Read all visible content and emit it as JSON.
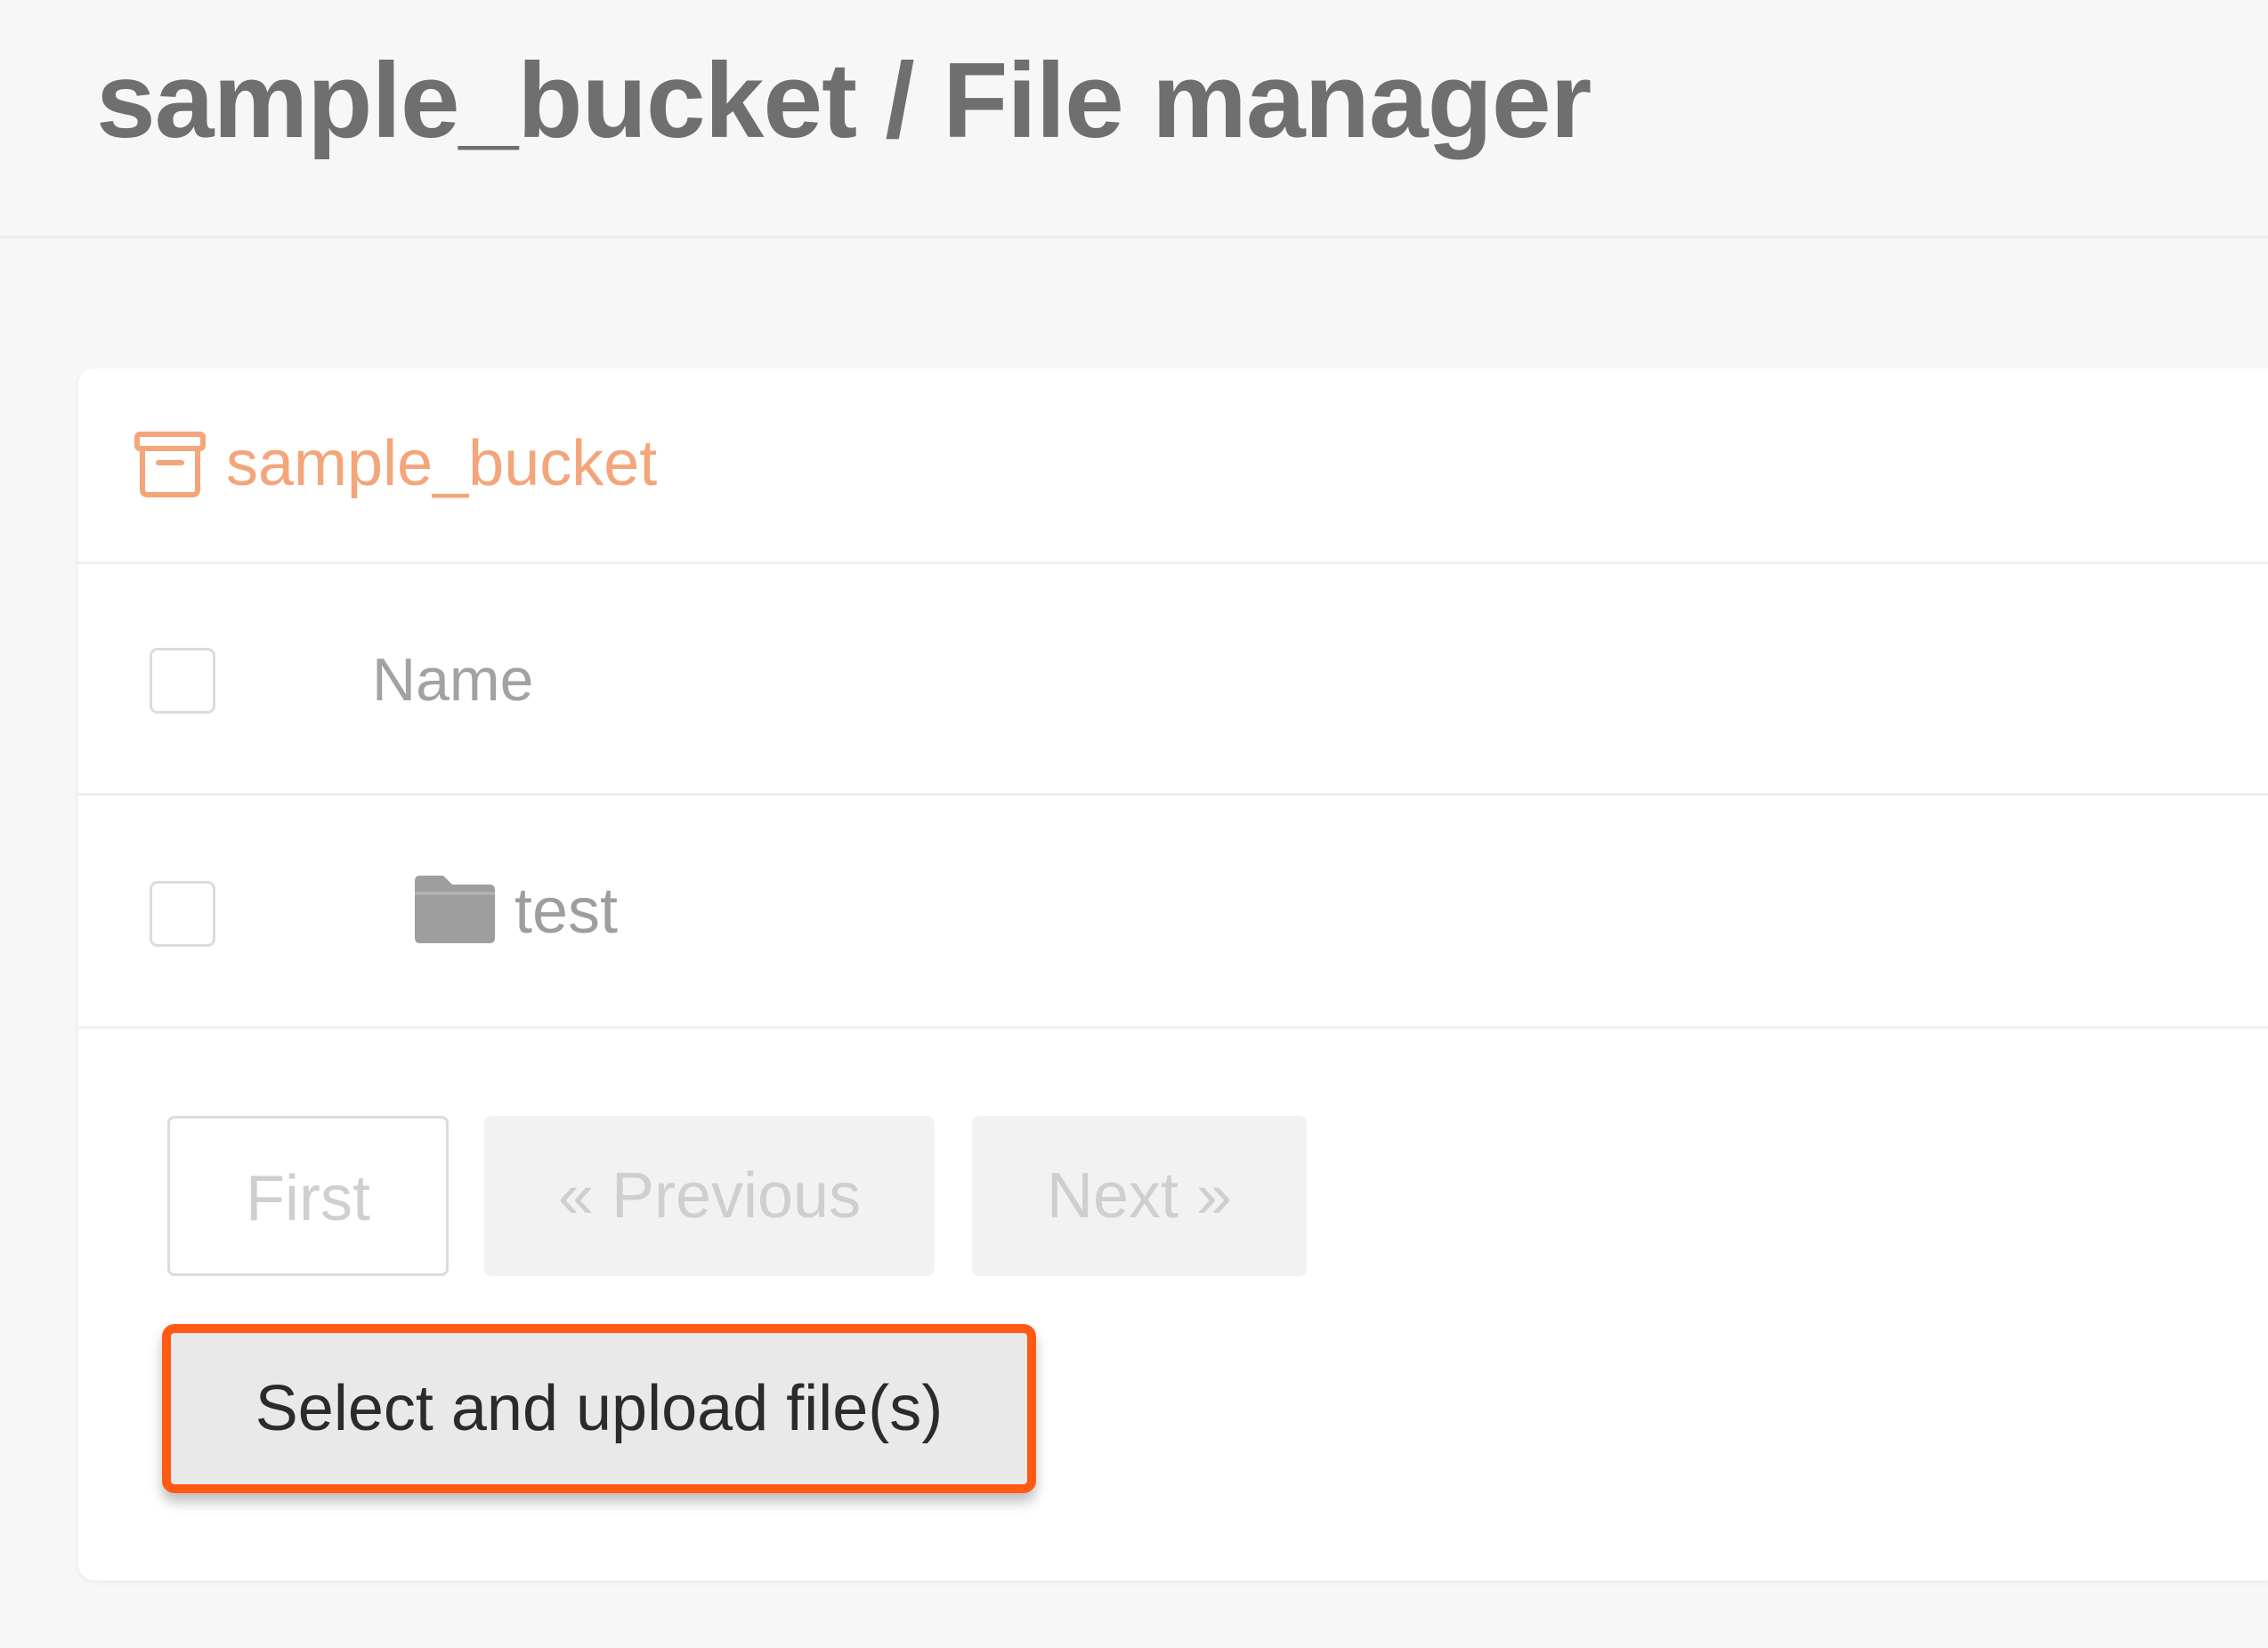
{
  "header": {
    "title": "sample_bucket / File manager"
  },
  "bucket": {
    "name": "sample_bucket",
    "icon": "archive-box-icon",
    "accent_color": "#f4a57a"
  },
  "table": {
    "columns": [
      "Name"
    ],
    "rows": [
      {
        "type": "folder",
        "icon": "folder-icon",
        "name": "test"
      }
    ]
  },
  "pagination": {
    "first_label": "First",
    "previous_label": "« Previous",
    "next_label": "Next »"
  },
  "upload": {
    "label": "Select and upload file(s)",
    "highlight_color": "#ff5a14"
  }
}
